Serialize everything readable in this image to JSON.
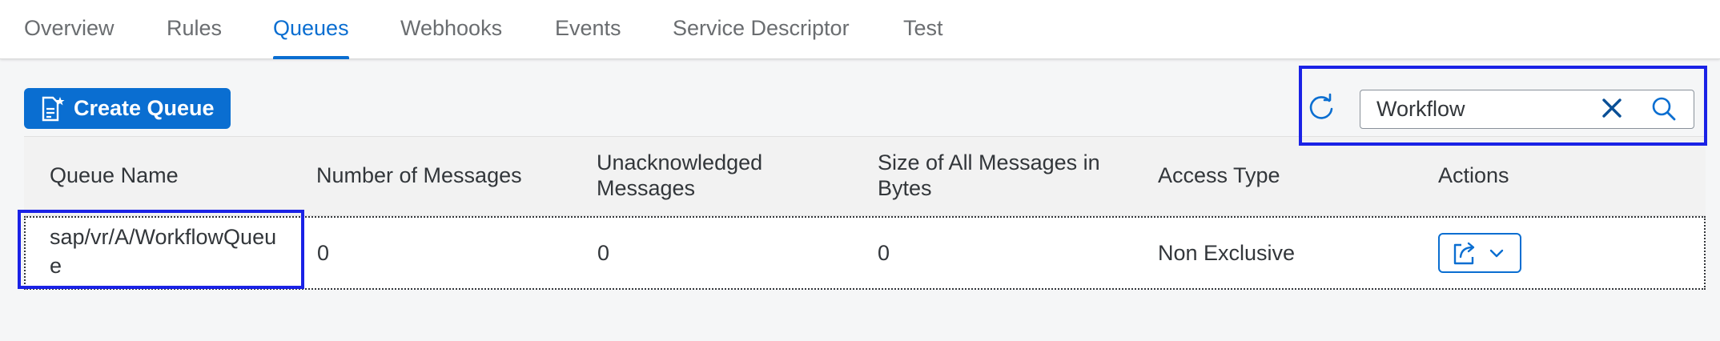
{
  "tabs": [
    {
      "label": "Overview"
    },
    {
      "label": "Rules"
    },
    {
      "label": "Queues",
      "active": true
    },
    {
      "label": "Webhooks"
    },
    {
      "label": "Events"
    },
    {
      "label": "Service Descriptor"
    },
    {
      "label": "Test"
    }
  ],
  "toolbar": {
    "create_label": "Create Queue",
    "search_value": "Workflow",
    "refresh_icon": "refresh-icon",
    "clear_icon": "close-icon",
    "search_icon": "search-icon"
  },
  "table": {
    "columns": [
      {
        "line1": "Queue Name",
        "line2": ""
      },
      {
        "line1": "Number of Messages",
        "line2": ""
      },
      {
        "line1": "Unacknowledged",
        "line2": "Messages"
      },
      {
        "line1": "Size of All Messages in",
        "line2": "Bytes"
      },
      {
        "line1": "Access Type",
        "line2": ""
      },
      {
        "line1": "Actions",
        "line2": ""
      }
    ],
    "rows": [
      {
        "queue_name_line1": "sap/vr/A/WorkflowQueu",
        "queue_name_line2": "e",
        "number_of_messages": "0",
        "unacknowledged": "0",
        "size_bytes": "0",
        "access_type": "Non Exclusive"
      }
    ]
  },
  "colors": {
    "accent": "#0a6ed1",
    "highlight": "#1a22e6",
    "text": "#32363a",
    "tab_inactive": "#6a6d70"
  }
}
